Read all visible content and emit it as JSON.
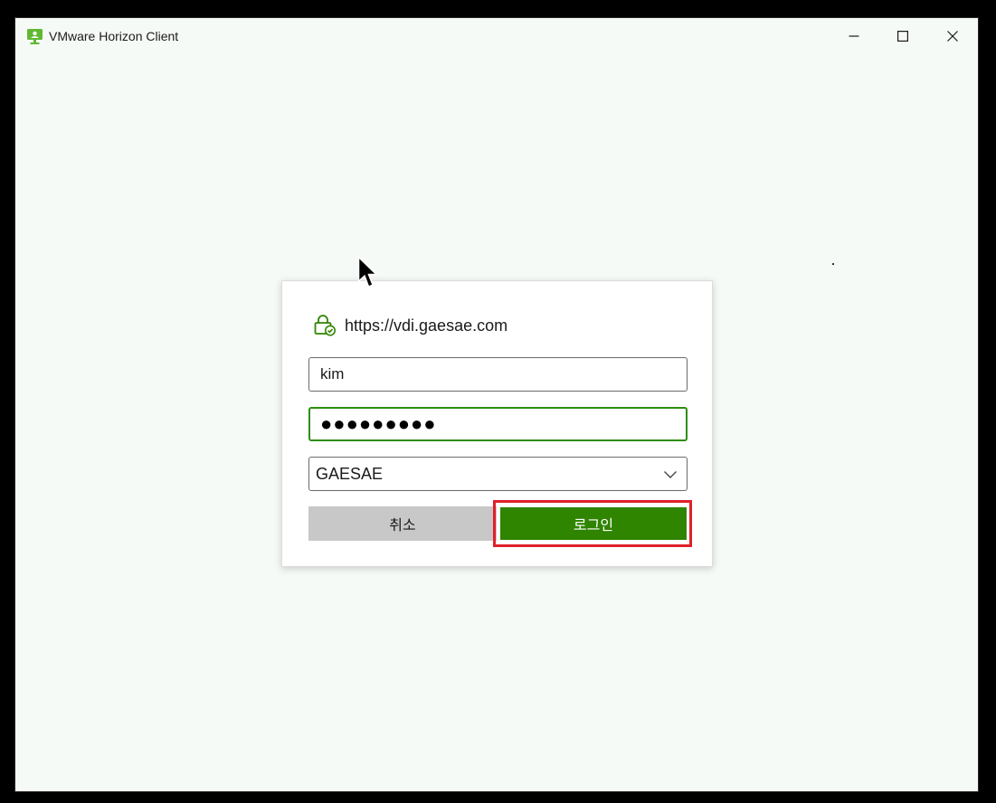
{
  "window": {
    "title": "VMware Horizon Client",
    "controls": {
      "minimize": "minimize-icon",
      "maximize": "maximize-icon",
      "close": "close-icon"
    }
  },
  "login_dialog": {
    "server_url": "https://vdi.gaesae.com",
    "username": "kim",
    "password_mask": "●●●●●●●●●",
    "domain": "GAESAE",
    "cancel_label": "취소",
    "login_label": "로그인"
  },
  "colors": {
    "accent_green": "#2f8400",
    "focus_border": "#2d8f0f",
    "highlight_red": "#e0202a",
    "cancel_gray": "#c8c8c8"
  }
}
